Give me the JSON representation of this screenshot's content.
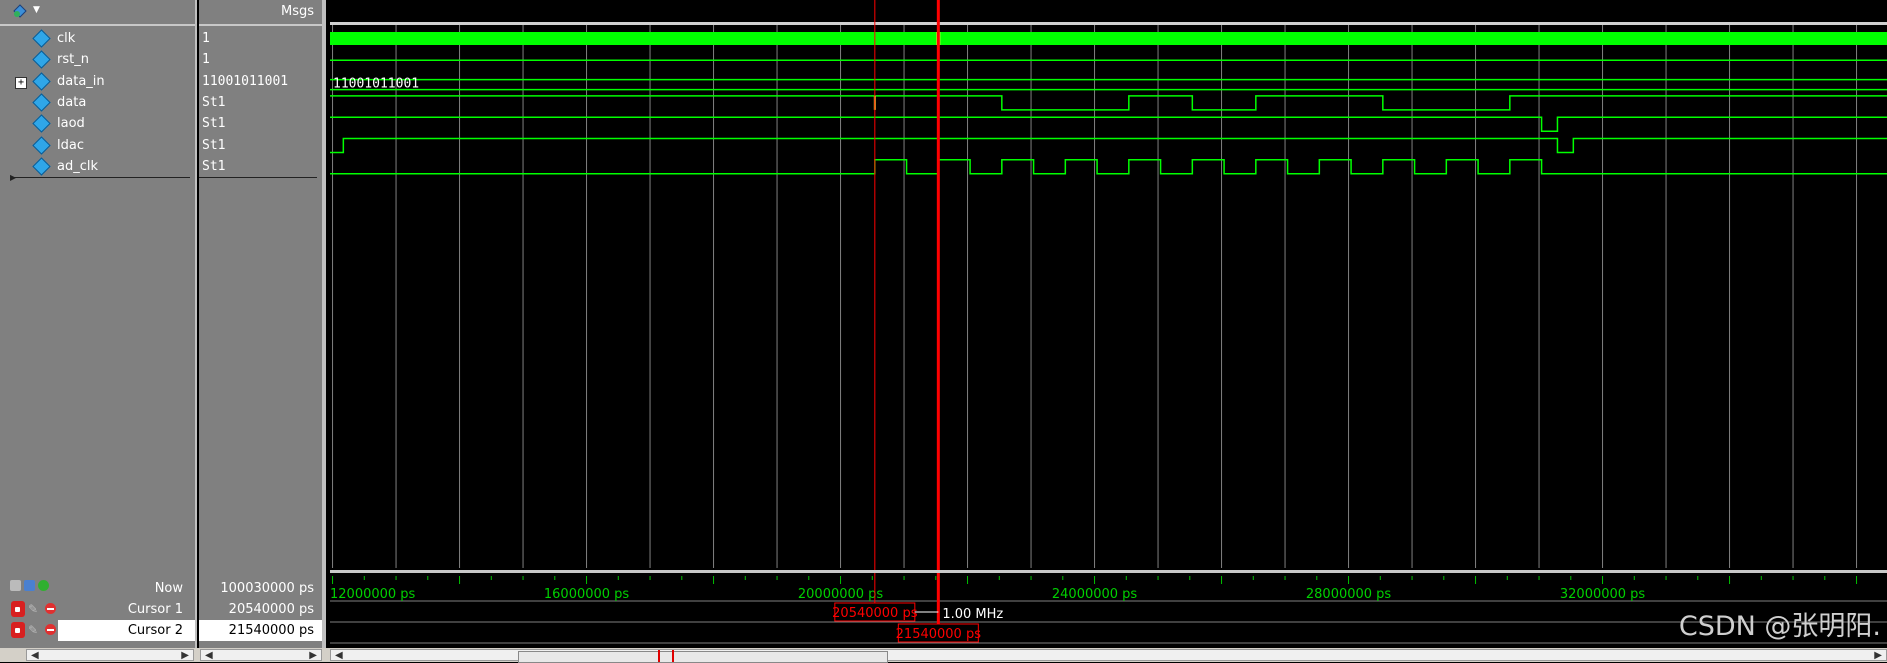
{
  "header": {
    "msgs_label": "Msgs"
  },
  "signals": [
    {
      "name": "clk",
      "value": "1",
      "expandable": false
    },
    {
      "name": "rst_n",
      "value": "1",
      "expandable": false
    },
    {
      "name": "data_in",
      "value": "11001011001",
      "expandable": true
    },
    {
      "name": "data",
      "value": "St1",
      "expandable": false
    },
    {
      "name": "laod",
      "value": "St1",
      "expandable": false
    },
    {
      "name": "ldac",
      "value": "St1",
      "expandable": false
    },
    {
      "name": "ad_clk",
      "value": "St1",
      "expandable": false
    }
  ],
  "bus_label": "11001011001",
  "bottom": {
    "now_label": "Now",
    "now_value": "100030000 ps",
    "cursor1_label": "Cursor 1",
    "cursor1_value": "20540000 ps",
    "cursor2_label": "Cursor 2",
    "cursor2_value": "21540000 ps"
  },
  "timeline": {
    "ticks": [
      {
        "label": "12000000 ps",
        "t": 12000000
      },
      {
        "label": "16000000 ps",
        "t": 16000000
      },
      {
        "label": "20000000 ps",
        "t": 20000000
      },
      {
        "label": "24000000 ps",
        "t": 24000000
      },
      {
        "label": "28000000 ps",
        "t": 28000000
      },
      {
        "label": "32000000 ps",
        "t": 32000000
      }
    ],
    "cursor1_label": "20540000 ps",
    "cursor2_label": "21540000 ps",
    "freq_label": "1.00 MHz",
    "cursor1_t": 20540000,
    "cursor2_t": 21540000
  },
  "watermark": "CSDN @张明阳.",
  "colors": {
    "wave": "#00ff00",
    "cursor": "#ff0000",
    "grid": "#808080"
  }
}
